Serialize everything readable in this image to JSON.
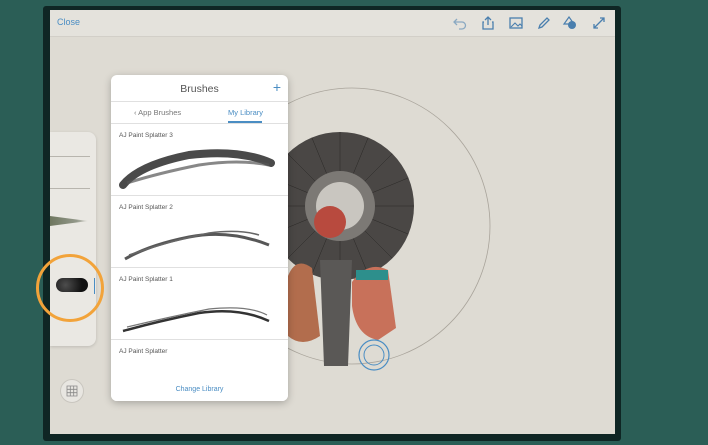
{
  "topbar": {
    "close_label": "Close",
    "icons": [
      "undo-icon",
      "share-icon",
      "image-icon",
      "pen-icon",
      "shapes-icon",
      "expand-icon"
    ]
  },
  "panel": {
    "title": "Brushes",
    "tabs": [
      {
        "label": "‹ App Brushes",
        "active": false
      },
      {
        "label": "My Library",
        "active": true
      }
    ],
    "items": [
      {
        "label": "AJ Paint Splatter 3"
      },
      {
        "label": "AJ Paint Splatter 2"
      },
      {
        "label": "AJ Paint Splatter 1"
      },
      {
        "label": "AJ Paint Splatter"
      }
    ],
    "change_label": "Change Library"
  },
  "colors": {
    "accent": "#4a8dc3",
    "highlight": "#f2a33a",
    "background": "#2b5e56",
    "canvas": "#dedbd3"
  }
}
